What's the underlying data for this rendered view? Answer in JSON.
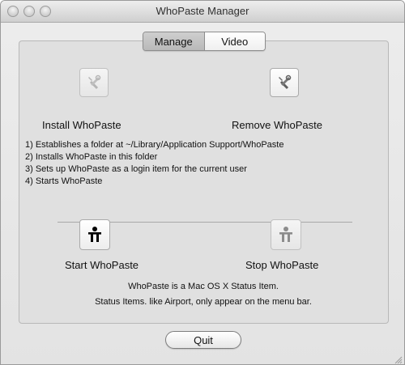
{
  "window": {
    "title": "WhoPaste Manager"
  },
  "tabs": [
    {
      "label": "Manage",
      "selected": true
    },
    {
      "label": "Video",
      "selected": false
    }
  ],
  "install": {
    "label": "Install WhoPaste",
    "icon": "tools-icon"
  },
  "remove": {
    "label": "Remove WhoPaste",
    "icon": "tools-icon"
  },
  "steps": [
    "1) Establishes a folder at ~/Library/Application Support/WhoPaste",
    "2) Installs WhoPaste in this folder",
    "3) Sets up WhoPaste as a login item for the current user",
    "4) Starts WhoPaste"
  ],
  "start": {
    "label": "Start WhoPaste",
    "icon": "person-icon"
  },
  "stop": {
    "label": "Stop WhoPaste",
    "icon": "person-icon"
  },
  "notes": [
    "WhoPaste is a Mac OS X Status Item.",
    "Status Items. like Airport, only appear on the menu bar."
  ],
  "quit_label": "Quit"
}
